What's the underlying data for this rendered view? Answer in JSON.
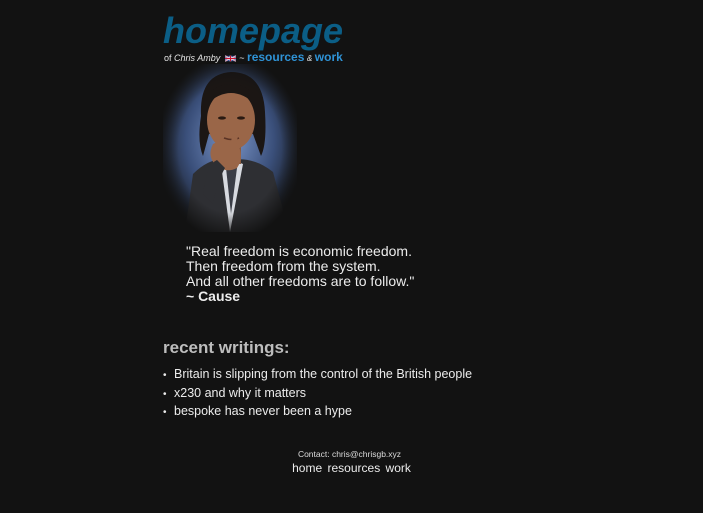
{
  "header": {
    "title": "homepage",
    "prefix": "of",
    "author_name": "Chris Amby",
    "flag_icon": "uk-flag-icon",
    "separator": "~",
    "resources_link": "resources",
    "ampersand": "&",
    "work_link": "work"
  },
  "portrait": {
    "icon": "portrait-photo"
  },
  "quote": {
    "line1": "\"Real freedom is economic freedom.",
    "line2": "Then freedom from the system.",
    "line3": "And all other freedoms are to follow.\"",
    "author": "~ Cause"
  },
  "writings": {
    "heading": "recent writings:",
    "items": [
      "Britain is slipping from the control of the British people",
      "x230 and why it matters",
      "bespoke has never been a hype"
    ]
  },
  "footer": {
    "contact": "Contact: chris@chrisgb.xyz",
    "nav": [
      "home",
      "resources",
      "work"
    ]
  },
  "colors": {
    "background": "#121212",
    "title": "#0b5e86",
    "link": "#2f93d6",
    "text": "#e6e6e6"
  }
}
